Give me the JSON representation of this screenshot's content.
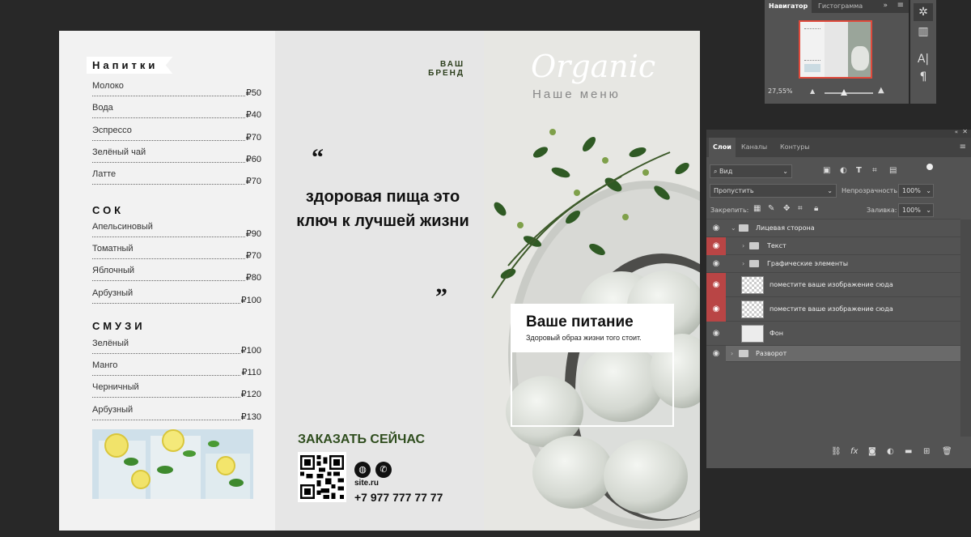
{
  "document": {
    "drinks": {
      "title": "Напитки",
      "items": [
        {
          "name": "Молоко",
          "price": "₽50"
        },
        {
          "name": "Вода",
          "price": "₽40"
        },
        {
          "name": "Эспрессо",
          "price": "₽70"
        },
        {
          "name": "Зелёный чай",
          "price": "₽60"
        },
        {
          "name": "Латте",
          "price": "₽70"
        }
      ]
    },
    "juice": {
      "title": "СОК",
      "items": [
        {
          "name": "Апельсиновый",
          "price": "₽90"
        },
        {
          "name": "Томатный",
          "price": "₽70"
        },
        {
          "name": "Яблочный",
          "price": "₽80"
        },
        {
          "name": "Арбузный",
          "price": "₽100"
        }
      ]
    },
    "smoothie": {
      "title": "СМУЗИ",
      "items": [
        {
          "name": "Зелёный",
          "price": "₽100"
        },
        {
          "name": "Манго",
          "price": "₽110"
        },
        {
          "name": "Черничный",
          "price": "₽120"
        },
        {
          "name": "Арбузный",
          "price": "₽130"
        }
      ]
    },
    "brand_line1": "ВАШ",
    "brand_line2": "БРЕНД",
    "quote_open": "“",
    "quote_close": "”",
    "slogan": "здоровая пища это ключ к лучшей жизни",
    "order_now": "ЗАКАЗАТЬ СЕЙЧАС",
    "site": "site.ru",
    "phone": "+7 977 777 77 77",
    "organic": "Organic",
    "menu_subtitle": "Наше меню",
    "card_title": "Ваше питание",
    "card_subtitle": "Здоровый образ жизни того стоит.",
    "web_icon": "globe-icon",
    "phone_icon": "phone-icon"
  },
  "navigator": {
    "tabs": [
      "Навигатор",
      "Гистограмма"
    ],
    "zoom": "27,55%",
    "accent": "#e04a3c"
  },
  "layers": {
    "tabs": [
      "Слои",
      "Каналы",
      "Контуры"
    ],
    "filter": "Вид",
    "blend_mode": "Пропустить",
    "opacity_label": "Непрозрачность:",
    "opacity": "100%",
    "lock_label": "Закрепить:",
    "fill_label": "Заливка:",
    "fill": "100%",
    "items": [
      {
        "name": "Лицевая сторона",
        "type": "group",
        "expanded": true
      },
      {
        "name": "Текст",
        "type": "group",
        "eye_active": true
      },
      {
        "name": "Графические элементы",
        "type": "group"
      },
      {
        "name": "поместите ваше изображение сюда",
        "type": "smart",
        "eye_active": true
      },
      {
        "name": "поместите ваше изображение сюда",
        "type": "smart",
        "eye_active": true
      },
      {
        "name": "Фон",
        "type": "layer"
      },
      {
        "name": "Разворот",
        "type": "group"
      }
    ],
    "eye_active_color": "#b94545"
  }
}
